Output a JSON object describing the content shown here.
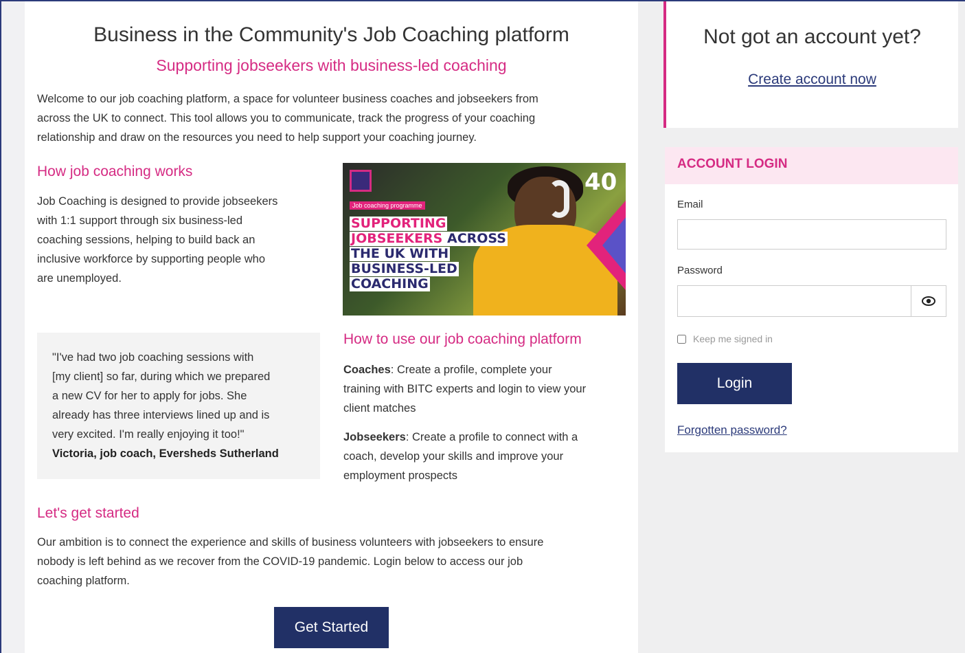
{
  "main": {
    "title": "Business in the Community's Job Coaching platform",
    "subtitle": "Supporting jobseekers with business-led coaching",
    "intro_lines": [
      "Welcome to our job coaching platform, a space for volunteer business coaches and jobseekers from",
      "across the UK to connect. This tool allows you to communicate, track the progress of your coaching",
      "relationship and draw on the resources you need to help support your coaching journey."
    ],
    "how_works": {
      "heading": "How job coaching works",
      "lines": [
        "Job Coaching is designed to provide jobseekers",
        "with 1:1 support through six business-led",
        "coaching sessions, helping to build back an",
        "inclusive workforce by supporting people who",
        "are unemployed."
      ]
    },
    "hero": {
      "tag": "Job coaching programme",
      "line1a": "SUPPORTING",
      "line2a": "JOBSEEKERS",
      "line2b": " ACROSS",
      "line3": "THE UK WITH",
      "line4": "BUSINESS-LED",
      "line5": "COACHING",
      "badge": "40"
    },
    "quote": {
      "lines": [
        "\"I've had two job coaching sessions with",
        "[my client] so far, during which we prepared",
        "a new CV for her to apply for jobs. She",
        "already has three interviews lined up and is",
        "very excited. I'm really enjoying it too!\""
      ],
      "attribution": "Victoria, job coach, Eversheds Sutherland"
    },
    "how_use": {
      "heading": "How to use our job coaching platform",
      "coaches_label": "Coaches",
      "coaches_lines": [
        ": Create a profile, complete your",
        "training with BITC experts and login to view your",
        "client matches"
      ],
      "jobseekers_label": "Jobseekers",
      "jobseekers_lines": [
        ": Create a profile to connect with a",
        "coach, develop your skills and improve your",
        "employment prospects"
      ]
    },
    "get_started": {
      "heading": "Let's get started",
      "lines": [
        "Our ambition is to connect the experience and skills of business volunteers with jobseekers to ensure",
        "nobody is left behind as we recover from the COVID-19 pandemic. Login below to access our job",
        "coaching platform."
      ],
      "button": "Get Started"
    }
  },
  "account": {
    "question": "Not got an account yet?",
    "create_link": "Create account now"
  },
  "login": {
    "heading": "ACCOUNT LOGIN",
    "email_label": "Email",
    "password_label": "Password",
    "eye_icon": "eye-icon",
    "keep_signed_in": "Keep me signed in",
    "button": "Login",
    "forgot": "Forgotten password?"
  },
  "colors": {
    "accent_pink": "#d52b83",
    "navy": "#213066",
    "link": "#2b3a7a"
  }
}
